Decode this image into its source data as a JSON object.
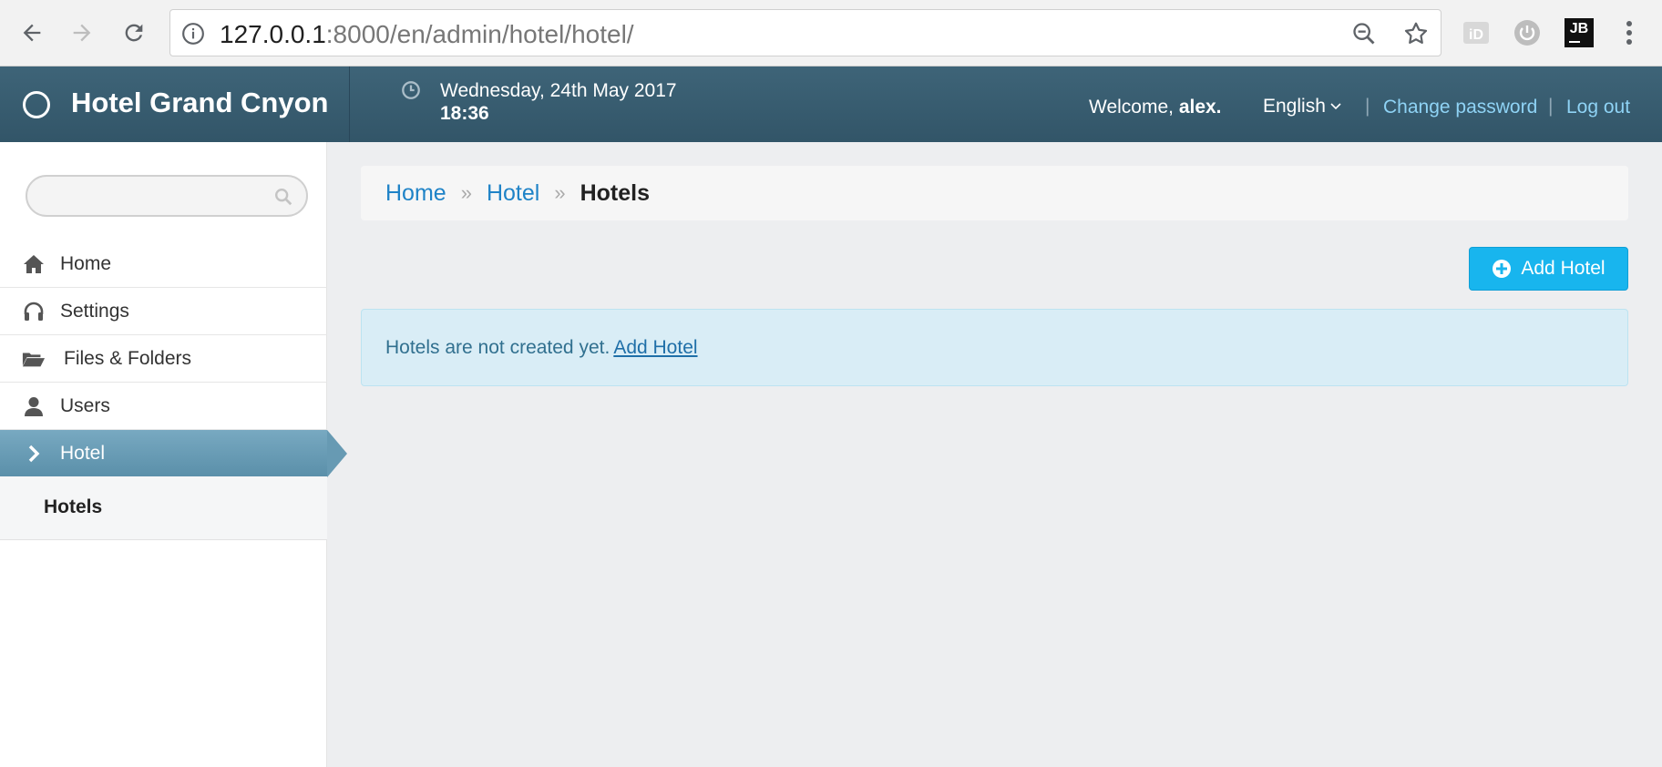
{
  "browser": {
    "url_host": "127.0.0.1",
    "url_rest": ":8000/en/admin/hotel/hotel/",
    "ext_jb_label": "JB"
  },
  "header": {
    "brand": "Hotel Grand Cnyon",
    "date": "Wednesday, 24th May 2017",
    "time": "18:36",
    "welcome_prefix": "Welcome, ",
    "username": "alex.",
    "language": "English",
    "separator": "|",
    "change_password": "Change password",
    "log_out": "Log out"
  },
  "sidebar": {
    "search_placeholder": "",
    "items": [
      {
        "label": "Home",
        "icon": "home-icon"
      },
      {
        "label": "Settings",
        "icon": "headphones-icon"
      },
      {
        "label": "Files & Folders",
        "icon": "folder-open-icon"
      },
      {
        "label": "Users",
        "icon": "user-icon"
      },
      {
        "label": "Hotel",
        "icon": "chevron-right-icon",
        "active": true
      }
    ],
    "sub_items": [
      {
        "label": "Hotels"
      }
    ]
  },
  "breadcrumb": {
    "items": [
      "Home",
      "Hotel"
    ],
    "separator": "»",
    "current": "Hotels"
  },
  "toolbar": {
    "add_label": "Add Hotel"
  },
  "notice": {
    "text": "Hotels are not created yet.",
    "link": "Add Hotel"
  },
  "colors": {
    "header_bg": "#3a5f73",
    "accent": "#18b5ee",
    "link": "#1f83c7",
    "active_nav": "#679ab3",
    "notice_bg": "#d9edf6"
  }
}
